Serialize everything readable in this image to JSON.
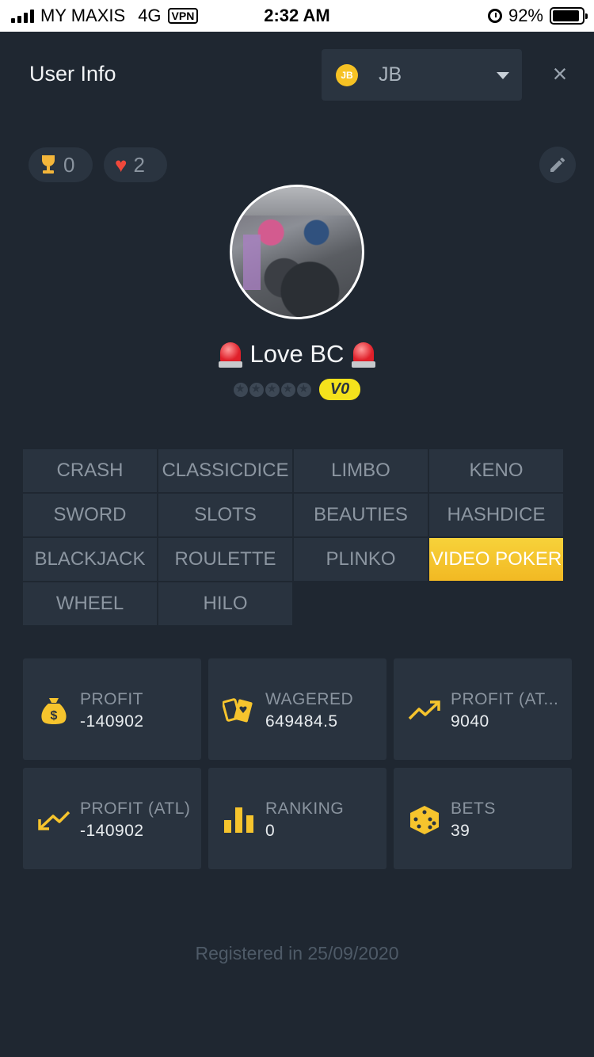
{
  "status_bar": {
    "carrier": "MY MAXIS",
    "network": "4G",
    "vpn": "VPN",
    "time": "2:32 AM",
    "battery": "92%"
  },
  "header": {
    "title": "User Info",
    "currency_icon": "JB",
    "currency": "JB",
    "close_icon": "×"
  },
  "badges": {
    "trophy_count": "0",
    "heart_count": "2"
  },
  "user": {
    "name": "Love BC",
    "level": "V0",
    "stars_filled": 0,
    "stars_total": 5
  },
  "games": {
    "tabs": [
      "CRASH",
      "CLASSICDICE",
      "LIMBO",
      "KENO",
      "SWORD",
      "SLOTS",
      "BEAUTIES",
      "HASHDICE",
      "BLACKJACK",
      "ROULETTE",
      "PLINKO",
      "VIDEO POKER",
      "WHEEL",
      "HILO"
    ],
    "active": "VIDEO POKER"
  },
  "stats": [
    {
      "label": "PROFIT",
      "value": "-140902",
      "icon": "money-bag-icon"
    },
    {
      "label": "WAGERED",
      "value": "649484.5",
      "icon": "cards-icon"
    },
    {
      "label": "PROFIT (AT...",
      "value": "9040",
      "icon": "trend-up-icon"
    },
    {
      "label": "PROFIT (ATL)",
      "value": "-140902",
      "icon": "trend-down-icon"
    },
    {
      "label": "RANKING",
      "value": "0",
      "icon": "bar-chart-icon"
    },
    {
      "label": "BETS",
      "value": "39",
      "icon": "dice-icon"
    }
  ],
  "footer": {
    "registered": "Registered in 25/09/2020"
  },
  "colors": {
    "background": "#1f2731",
    "card": "#29333f",
    "accent": "#f4c02a",
    "muted_text": "#8a949f"
  }
}
